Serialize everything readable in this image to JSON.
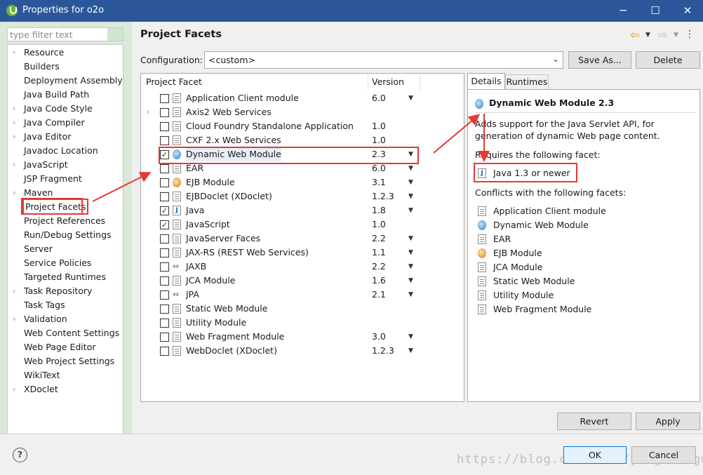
{
  "window": {
    "title": "Properties for o2o",
    "app_icon": "spring-leaf-icon",
    "controls": [
      "─",
      "☐",
      "✕"
    ]
  },
  "filter": {
    "placeholder": "type filter text"
  },
  "tree": {
    "items": [
      {
        "label": "Resource",
        "expandable": true
      },
      {
        "label": "Builders",
        "expandable": false
      },
      {
        "label": "Deployment Assembly",
        "expandable": false
      },
      {
        "label": "Java Build Path",
        "expandable": false
      },
      {
        "label": "Java Code Style",
        "expandable": true
      },
      {
        "label": "Java Compiler",
        "expandable": true
      },
      {
        "label": "Java Editor",
        "expandable": true
      },
      {
        "label": "Javadoc Location",
        "expandable": false
      },
      {
        "label": "JavaScript",
        "expandable": true
      },
      {
        "label": "JSP Fragment",
        "expandable": false
      },
      {
        "label": "Maven",
        "expandable": true
      },
      {
        "label": "Project Facets",
        "expandable": false,
        "selected": true
      },
      {
        "label": "Project References",
        "expandable": false
      },
      {
        "label": "Run/Debug Settings",
        "expandable": false
      },
      {
        "label": "Server",
        "expandable": false
      },
      {
        "label": "Service Policies",
        "expandable": false
      },
      {
        "label": "Targeted Runtimes",
        "expandable": false
      },
      {
        "label": "Task Repository",
        "expandable": true
      },
      {
        "label": "Task Tags",
        "expandable": false
      },
      {
        "label": "Validation",
        "expandable": true
      },
      {
        "label": "Web Content Settings",
        "expandable": false
      },
      {
        "label": "Web Page Editor",
        "expandable": false
      },
      {
        "label": "Web Project Settings",
        "expandable": false
      },
      {
        "label": "WikiText",
        "expandable": false
      },
      {
        "label": "XDoclet",
        "expandable": true
      }
    ]
  },
  "page": {
    "title": "Project Facets",
    "configuration_label": "Configuration:",
    "configuration_value": "<custom>",
    "save_as": "Save As...",
    "delete": "Delete"
  },
  "facets": {
    "columns": [
      "Project Facet",
      "Version"
    ],
    "rows": [
      {
        "name": "Application Client module",
        "version": "6.0",
        "checked": false,
        "icon": "document-icon",
        "dropdown": true
      },
      {
        "name": "Axis2 Web Services",
        "version": "",
        "checked": false,
        "icon": "document-icon",
        "dropdown": false,
        "expandable": true
      },
      {
        "name": "Cloud Foundry Standalone Application",
        "version": "1.0",
        "checked": false,
        "icon": "document-icon",
        "dropdown": false
      },
      {
        "name": "CXF 2.x Web Services",
        "version": "1.0",
        "checked": false,
        "icon": "document-icon",
        "dropdown": false
      },
      {
        "name": "Dynamic Web Module",
        "version": "2.3",
        "checked": true,
        "icon": "globe-icon",
        "dropdown": true,
        "selected": true
      },
      {
        "name": "EAR",
        "version": "6.0",
        "checked": false,
        "icon": "document-icon",
        "dropdown": true
      },
      {
        "name": "EJB Module",
        "version": "3.1",
        "checked": false,
        "icon": "ejb-icon",
        "dropdown": true
      },
      {
        "name": "EJBDoclet (XDoclet)",
        "version": "1.2.3",
        "checked": false,
        "icon": "document-icon",
        "dropdown": true
      },
      {
        "name": "Java",
        "version": "1.8",
        "checked": true,
        "icon": "java-icon",
        "dropdown": true
      },
      {
        "name": "JavaScript",
        "version": "1.0",
        "checked": true,
        "icon": "document-icon",
        "dropdown": false
      },
      {
        "name": "JavaServer Faces",
        "version": "2.2",
        "checked": false,
        "icon": "document-icon",
        "dropdown": true
      },
      {
        "name": "JAX-RS (REST Web Services)",
        "version": "1.1",
        "checked": false,
        "icon": "document-icon",
        "dropdown": true
      },
      {
        "name": "JAXB",
        "version": "2.2",
        "checked": false,
        "icon": "arrows-icon",
        "dropdown": true
      },
      {
        "name": "JCA Module",
        "version": "1.6",
        "checked": false,
        "icon": "document-icon",
        "dropdown": true
      },
      {
        "name": "JPA",
        "version": "2.1",
        "checked": false,
        "icon": "arrows-icon",
        "dropdown": true
      },
      {
        "name": "Static Web Module",
        "version": "",
        "checked": false,
        "icon": "document-icon",
        "dropdown": false
      },
      {
        "name": "Utility Module",
        "version": "",
        "checked": false,
        "icon": "document-icon",
        "dropdown": false
      },
      {
        "name": "Web Fragment Module",
        "version": "3.0",
        "checked": false,
        "icon": "document-icon",
        "dropdown": true
      },
      {
        "name": "WebDoclet (XDoclet)",
        "version": "1.2.3",
        "checked": false,
        "icon": "document-icon",
        "dropdown": true
      }
    ]
  },
  "details": {
    "tabs": [
      "Details",
      "Runtimes"
    ],
    "title": "Dynamic Web Module 2.3",
    "description_line1": "Adds support for the Java Servlet API, for",
    "description_line2": "generation of dynamic Web page content.",
    "requires_label": "Requires the following facet:",
    "requires": "Java 1.3 or newer",
    "conflicts_label": "Conflicts with the following facets:",
    "conflicts": [
      {
        "label": "Application Client module",
        "icon": "document-icon"
      },
      {
        "label": "Dynamic Web Module",
        "icon": "globe-icon"
      },
      {
        "label": "EAR",
        "icon": "document-icon"
      },
      {
        "label": "EJB Module",
        "icon": "ejb-icon"
      },
      {
        "label": "JCA Module",
        "icon": "document-icon"
      },
      {
        "label": "Static Web Module",
        "icon": "document-icon"
      },
      {
        "label": "Utility Module",
        "icon": "document-icon"
      },
      {
        "label": "Web Fragment Module",
        "icon": "document-icon"
      }
    ]
  },
  "buttons": {
    "revert": "Revert",
    "apply": "Apply",
    "ok": "OK",
    "cancel": "Cancel",
    "help": "?"
  },
  "watermark": "https://blog.csdn.net/yangshangwei",
  "colors": {
    "titlebar": "#2b579a",
    "annotation": "#e53935",
    "leftpane": "#dbe9da"
  }
}
